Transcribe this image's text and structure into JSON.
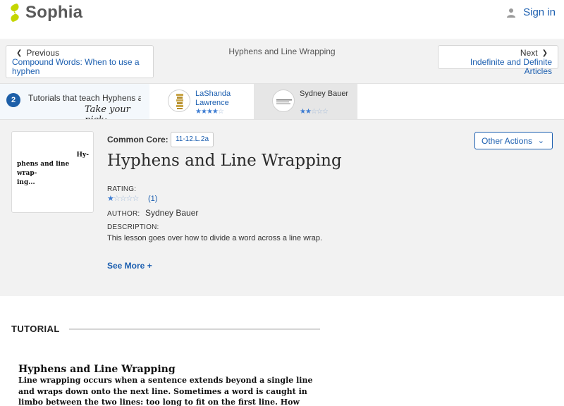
{
  "header": {
    "logo_text": "Sophia",
    "signin_label": "Sign in",
    "brand_color": "#c4d600"
  },
  "navigation": {
    "prev_direction": "Previous",
    "prev_title": "Compound Words: When to use a hyphen",
    "current_title": "Hyphens and Line Wrapping",
    "next_direction": "Next",
    "next_title": "Indefinite and Definite Articles"
  },
  "tutorials_strip": {
    "count": "2",
    "intro_text": "Tutorials that teach Hyphens and Line Wrapping",
    "pick_text": "Take your pick:",
    "tutors": [
      {
        "name": "LaShanda Lawrence",
        "rating_filled": 3.5,
        "rating_max": 5
      },
      {
        "name": "Sydney Bauer",
        "rating_filled": 2,
        "rating_max": 5
      }
    ]
  },
  "lesson": {
    "thumbnail_lines": [
      "Hy-",
      "phens and line wrap-",
      "ing..."
    ],
    "common_core_label": "Common Core:",
    "common_core_code": "11-12.L.2a",
    "title": "Hyphens and Line Wrapping",
    "rating_label": "RATING:",
    "rating_filled": 1,
    "rating_max": 5,
    "rating_count": "(1)",
    "author_label": "AUTHOR:",
    "author_name": "Sydney Bauer",
    "description_label": "DESCRIPTION:",
    "description": "This lesson goes over how to divide a word across a line wrap.",
    "see_more": "See More +",
    "other_actions": "Other Actions"
  },
  "tutorial": {
    "section_label": "TUTORIAL",
    "doc_title": "Hyphens and Line Wrapping",
    "doc_lines": [
      "Line wrapping occurs when a sentence extends beyond a single line",
      "and wraps down onto the next line. Sometimes a word is caught in",
      "limbo between the two lines: too long to fit on the first line. How"
    ]
  }
}
